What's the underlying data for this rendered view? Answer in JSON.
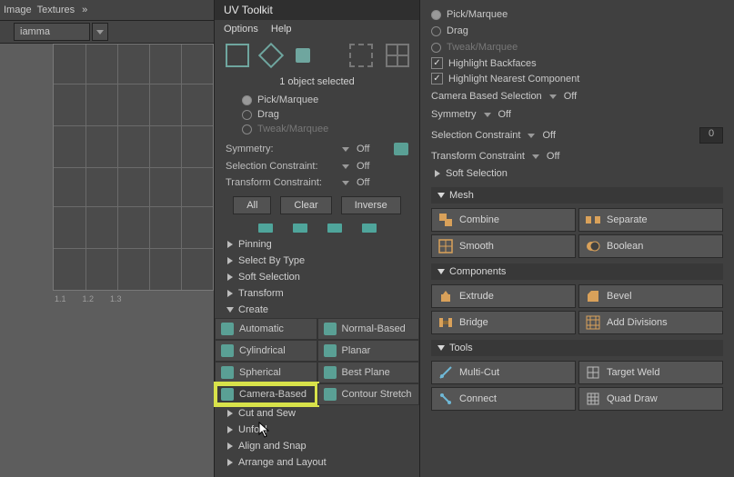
{
  "left": {
    "menu_image": "Image",
    "menu_textures": "Textures",
    "gamma_label": "iamma",
    "ruler": [
      "1.1",
      "1.2",
      "1.3"
    ]
  },
  "toolkit": {
    "title": "UV Toolkit",
    "menu_options": "Options",
    "menu_help": "Help",
    "info": "1 object selected",
    "radios": {
      "pick": "Pick/Marquee",
      "drag": "Drag",
      "tweak": "Tweak/Marquee"
    },
    "symmetry_label": "Symmetry:",
    "symmetry_value": "Off",
    "sel_constraint_label": "Selection Constraint:",
    "sel_constraint_value": "Off",
    "trans_constraint_label": "Transform Constraint:",
    "trans_constraint_value": "Off",
    "btn_all": "All",
    "btn_clear": "Clear",
    "btn_inverse": "Inverse",
    "tree": {
      "pinning": "Pinning",
      "select_by_type": "Select By Type",
      "soft_selection": "Soft Selection",
      "transform": "Transform",
      "create": "Create",
      "cut_sew": "Cut and Sew",
      "unfold": "Unfold",
      "align_snap": "Align and Snap",
      "arrange": "Arrange and Layout"
    },
    "create": {
      "automatic": "Automatic",
      "normal": "Normal-Based",
      "cylindrical": "Cylindrical",
      "planar": "Planar",
      "spherical": "Spherical",
      "best_plane": "Best Plane",
      "camera": "Camera-Based",
      "contour": "Contour Stretch"
    }
  },
  "right": {
    "radios": {
      "pick": "Pick/Marquee",
      "drag": "Drag",
      "tweak": "Tweak/Marquee"
    },
    "hl_backfaces": "Highlight Backfaces",
    "hl_nearest": "Highlight Nearest Component",
    "cam_sel_label": "Camera Based Selection",
    "cam_sel_value": "Off",
    "symmetry_label": "Symmetry",
    "symmetry_value": "Off",
    "sel_constraint_label": "Selection Constraint",
    "sel_constraint_value": "Off",
    "sel_constraint_num": "0",
    "trans_constraint_label": "Transform Constraint",
    "trans_constraint_value": "Off",
    "soft_selection": "Soft Selection",
    "sec_mesh": "Mesh",
    "sec_components": "Components",
    "sec_tools": "Tools",
    "mesh": {
      "combine": "Combine",
      "separate": "Separate",
      "smooth": "Smooth",
      "boolean": "Boolean"
    },
    "comp": {
      "extrude": "Extrude",
      "bevel": "Bevel",
      "bridge": "Bridge",
      "add_div": "Add Divisions"
    },
    "tools": {
      "multicut": "Multi-Cut",
      "target_weld": "Target Weld",
      "connect": "Connect",
      "quad_draw": "Quad Draw"
    }
  }
}
